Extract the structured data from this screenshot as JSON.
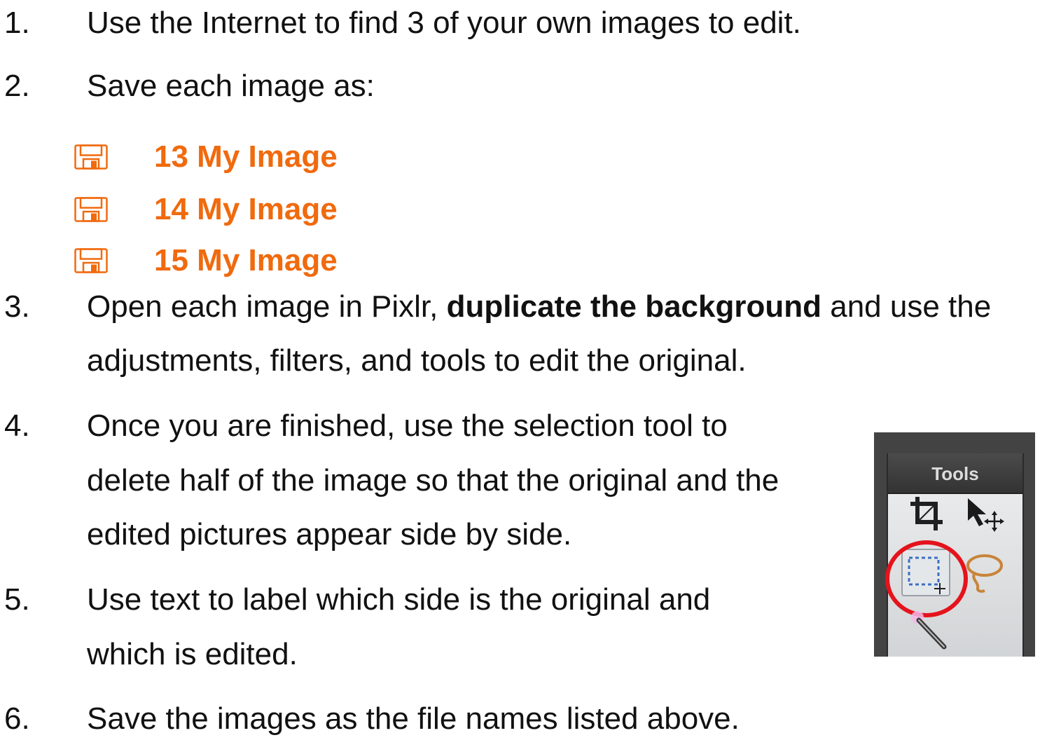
{
  "steps": [
    {
      "num": "1.",
      "lines": [
        {
          "parts": [
            {
              "text": "Use the Internet to find 3 of your own images to edit."
            }
          ]
        }
      ]
    },
    {
      "num": "2.",
      "lines": [
        {
          "parts": [
            {
              "text": "Save each image as:"
            }
          ]
        }
      ]
    },
    {
      "num": "3.",
      "lines": [
        {
          "parts": [
            {
              "text": "Open each image in Pixlr, "
            },
            {
              "text": "duplicate the background",
              "bold": true
            },
            {
              "text": " and use the"
            }
          ]
        },
        {
          "parts": [
            {
              "text": "adjustments, filters, and tools to edit the original."
            }
          ]
        }
      ]
    },
    {
      "num": "4.",
      "lines": [
        {
          "parts": [
            {
              "text": "Once you are finished, use the selection tool to"
            }
          ]
        },
        {
          "parts": [
            {
              "text": "delete half of the image so that the original and the"
            }
          ]
        },
        {
          "parts": [
            {
              "text": "edited pictures appear side by side."
            }
          ]
        }
      ]
    },
    {
      "num": "5.",
      "lines": [
        {
          "parts": [
            {
              "text": "Use text to label which side is the original and"
            }
          ]
        },
        {
          "parts": [
            {
              "text": "which is edited."
            }
          ]
        }
      ]
    },
    {
      "num": "6.",
      "lines": [
        {
          "parts": [
            {
              "text": "Save the images as the file names listed above."
            }
          ]
        }
      ]
    }
  ],
  "file_names": [
    {
      "name": "13 My Image",
      "icon": "floppy-disk-icon"
    },
    {
      "name": "14 My Image",
      "icon": "floppy-disk-icon"
    },
    {
      "name": "15 My Image",
      "icon": "floppy-disk-icon"
    }
  ],
  "tools_panel": {
    "title": "Tools",
    "icons": [
      "crop-icon",
      "move-icon",
      "marquee-select-icon",
      "lasso-icon",
      "magic-wand-icon"
    ],
    "highlight_color": "#e5131c"
  },
  "colors": {
    "filename": "#f06a0e",
    "text": "#111111"
  }
}
